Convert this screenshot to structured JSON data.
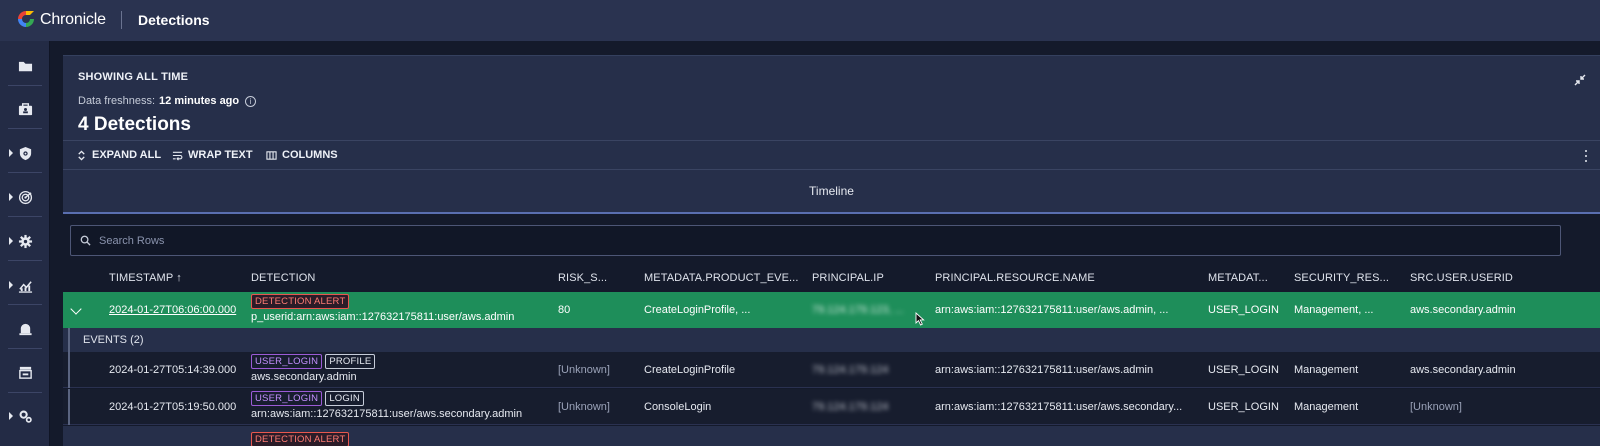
{
  "app": {
    "brand": "Chronicle",
    "page": "Detections"
  },
  "sidebar": {
    "items": [
      {
        "icon": "folder-icon",
        "caret": false
      },
      {
        "icon": "case-icon",
        "caret": false
      },
      {
        "icon": "shield-icon",
        "caret": true
      },
      {
        "icon": "radar-icon",
        "caret": true
      },
      {
        "icon": "gear-icon",
        "caret": true
      },
      {
        "icon": "chart-icon",
        "caret": true
      },
      {
        "icon": "bell-icon",
        "caret": false
      },
      {
        "icon": "store-icon",
        "caret": false
      },
      {
        "icon": "settings-gears-icon",
        "caret": true
      }
    ]
  },
  "header": {
    "showing": "SHOWING ALL TIME",
    "freshness_label": "Data freshness:",
    "freshness_value": "12 minutes ago",
    "detections_count": "4 Detections"
  },
  "toolbar": {
    "expand_all": "EXPAND ALL",
    "wrap_text": "WRAP TEXT",
    "columns": "COLUMNS"
  },
  "tabs": {
    "timeline": "Timeline"
  },
  "search": {
    "placeholder": "Search Rows"
  },
  "columns": [
    "TIMESTAMP",
    "DETECTION",
    "RISK_S...",
    "METADATA.PRODUCT_EVE...",
    "PRINCIPAL.IP",
    "PRINCIPAL.RESOURCE.NAME",
    "METADAT...",
    "SECURITY_RES...",
    "SRC.USER.USERID"
  ],
  "detection_row": {
    "timestamp": "2024-01-27T06:06:00.000",
    "tag": "DETECTION ALERT",
    "detection": "p_userid:arn:aws:iam::127632175811:user/aws.admin",
    "risk": "80",
    "product_event": "CreateLoginProfile, ...",
    "principal_ip": "79.124.179.123, ...",
    "resource_name": "arn:aws:iam::127632175811:user/aws.admin, ...",
    "metadata": "USER_LOGIN",
    "security_result": "Management, ...",
    "src_user": "aws.secondary.admin"
  },
  "events": {
    "header": "EVENTS (2)",
    "rows": [
      {
        "timestamp": "2024-01-27T05:14:39.000",
        "tag1": "USER_LOGIN",
        "tag2": "PROFILE",
        "detection": "aws.secondary.admin",
        "risk": "[Unknown]",
        "product_event": "CreateLoginProfile",
        "principal_ip": "79.124.179.124",
        "resource_name": "arn:aws:iam::127632175811:user/aws.admin",
        "metadata": "USER_LOGIN",
        "security_result": "Management",
        "src_user": "aws.secondary.admin"
      },
      {
        "timestamp": "2024-01-27T05:19:50.000",
        "tag1": "USER_LOGIN",
        "tag2": "LOGIN",
        "detection": "arn:aws:iam::127632175811:user/aws.secondary.admin",
        "risk": "[Unknown]",
        "product_event": "ConsoleLogin",
        "principal_ip": "79.124.179.124",
        "resource_name": "arn:aws:iam::127632175811:user/aws.secondary...",
        "metadata": "USER_LOGIN",
        "security_result": "Management",
        "src_user": "[Unknown]"
      }
    ]
  },
  "partial_row": {
    "tag": "DETECTION ALERT"
  },
  "colors": {
    "accent_green": "#1e8e5a",
    "alert_red": "#ff7b73",
    "login_purple": "#c490ff",
    "topbar": "#2a3350"
  }
}
